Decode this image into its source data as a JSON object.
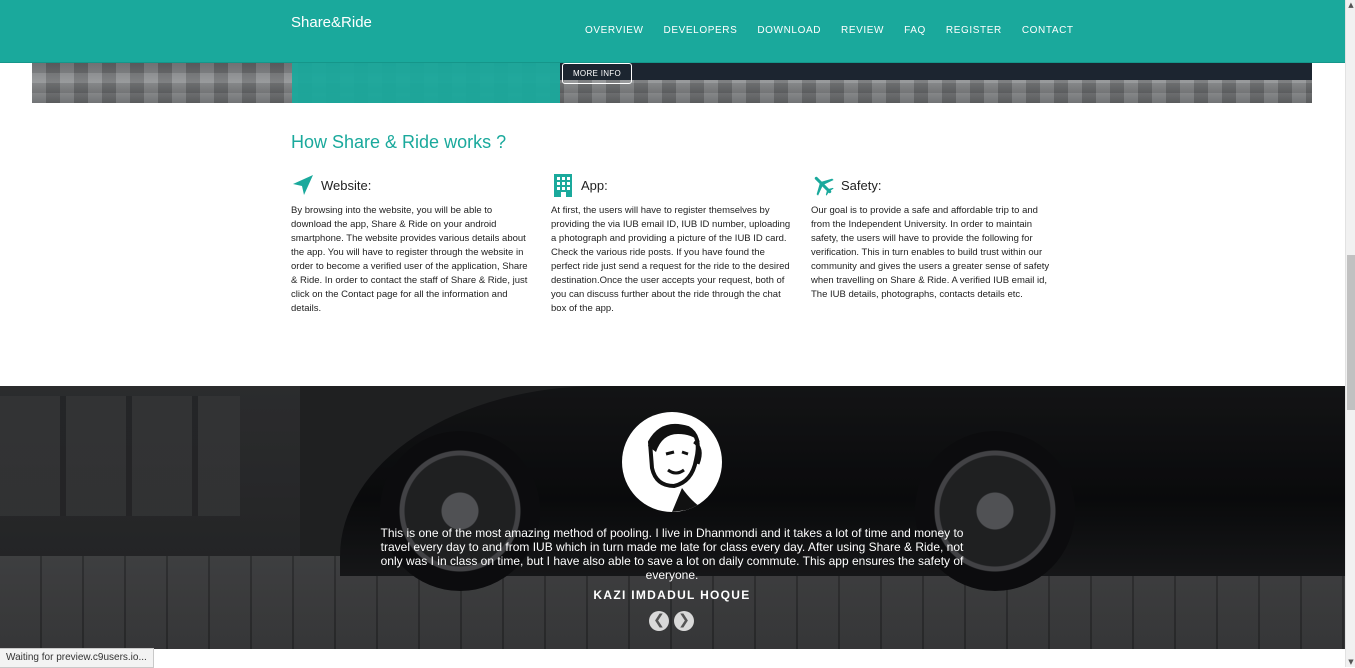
{
  "header": {
    "brand": "Share&Ride",
    "nav": [
      "OVERVIEW",
      "DEVELOPERS",
      "DOWNLOAD",
      "REVIEW",
      "FAQ",
      "REGISTER",
      "CONTACT"
    ]
  },
  "hero": {
    "more_info_label": "MORE INFO"
  },
  "how": {
    "title": "How Share & Ride works ?",
    "columns": [
      {
        "icon": "paper-plane-icon",
        "label": "Website:",
        "text": "By browsing into the website, you will be able to download the app, Share & Ride on your android smartphone. The website provides various details about the app. You will have to register through the website in order to become a verified user of the application, Share & Ride. In order to contact the staff of Share & Ride, just click on the Contact page for all the information and details."
      },
      {
        "icon": "building-icon",
        "label": "App:",
        "text": "At first, the users will have to register themselves by providing the via IUB email ID, IUB ID number, uploading a photograph and providing a picture of the IUB ID card. Check the various ride posts. If you have found the perfect ride just send a request for the ride to the desired destination.Once the user accepts your request, both of you can discuss further about the ride through the chat box of the app."
      },
      {
        "icon": "airplane-icon",
        "label": "Safety:",
        "text": "Our goal is to provide a safe and affordable trip to and from the Independent University. In order to maintain safety, the users will have to provide the following for verification. This in turn enables to build trust within our community and gives the users a greater sense of safety when travelling on Share & Ride. A verified IUB email id, The IUB details, photographs, contacts details etc."
      }
    ]
  },
  "testimonial": {
    "quote": "This is one of the most amazing method of pooling. I live in Dhanmondi and it takes a lot of time and money to travel every day to and from IUB which in turn made me late for class every day. After using Share & Ride, not only was I in class on time, but I have also able to save a lot on daily commute. This app ensures the safety of everyone.",
    "author": "KAZI IMDADUL HOQUE",
    "prev_symbol": "❮",
    "next_symbol": "❯"
  },
  "status_bar": {
    "text": "Waiting for preview.c9users.io..."
  },
  "colors": {
    "accent": "#1aa99c",
    "dark_bg": "#2a2b2d"
  }
}
